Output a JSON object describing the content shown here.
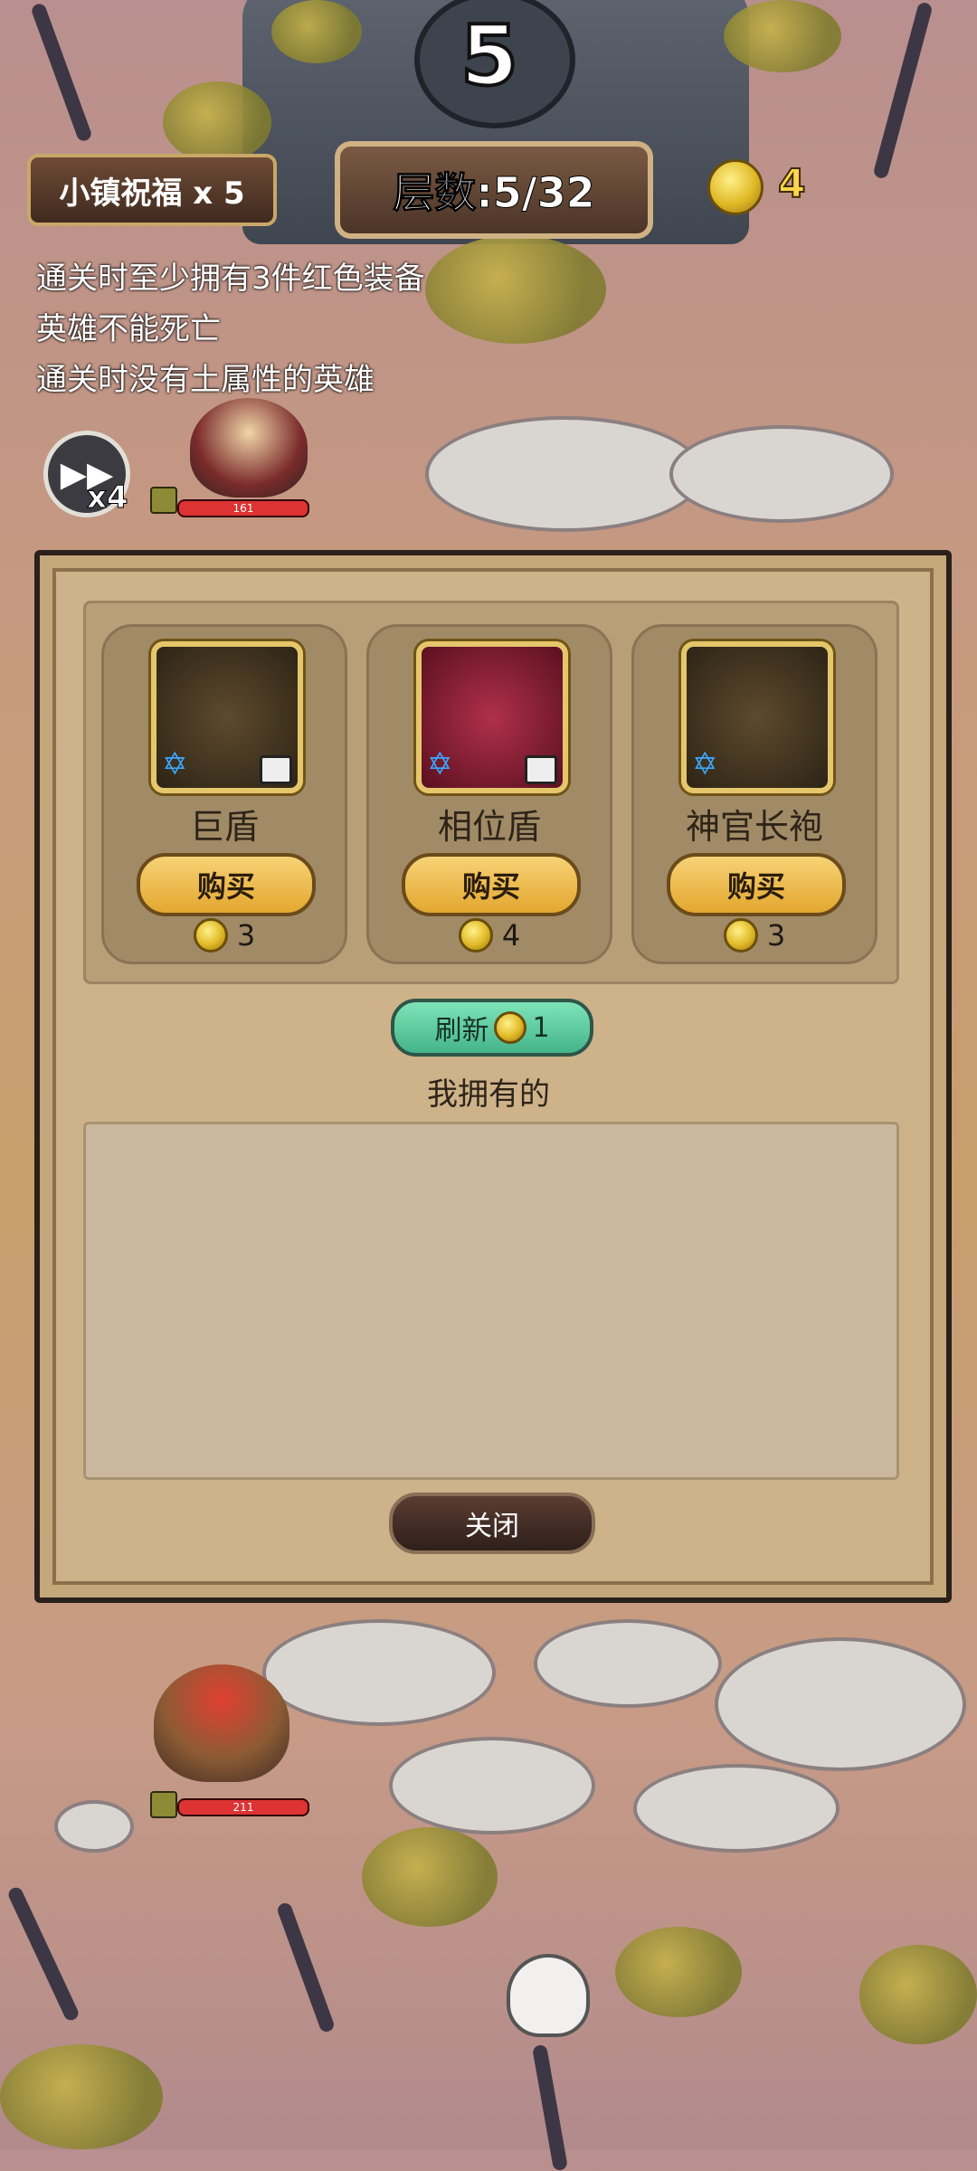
{
  "level_display": "5",
  "hud": {
    "blessing": "小镇祝福 x 5",
    "floor": "层数:5/32",
    "gold": "4",
    "speed": "x4"
  },
  "conditions": [
    "通关时至少拥有3件红色装备",
    "英雄不能死亡",
    "通关时没有土属性的英雄"
  ],
  "heroes": [
    {
      "hp": "161"
    },
    {
      "hp": "211"
    }
  ],
  "shop": {
    "items": [
      {
        "name": "巨盾",
        "buy": "购买",
        "price": "3",
        "icon": "shield-icon"
      },
      {
        "name": "相位盾",
        "buy": "购买",
        "price": "4",
        "icon": "phase-shield-icon"
      },
      {
        "name": "神官长袍",
        "buy": "购买",
        "price": "3",
        "icon": "priest-robe-icon"
      }
    ],
    "refresh_label": "刷新",
    "refresh_cost": "1",
    "owned_label": "我拥有的",
    "close_label": "关闭"
  }
}
